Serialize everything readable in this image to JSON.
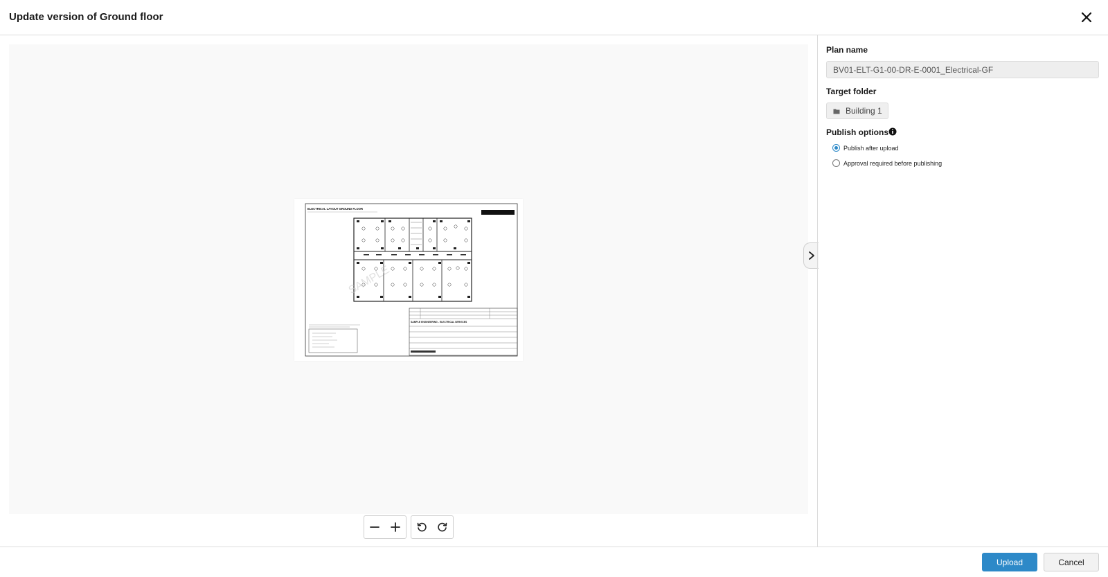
{
  "dialog": {
    "title": "Update version of Ground floor",
    "close_icon": "close-icon"
  },
  "preview": {
    "sheet": {
      "heading": "ELECTRICAL LAYOUT GROUND FLOOR",
      "title_block": "SAMPLE ENGINEERING - ELECTRICAL SERVICES",
      "watermark": "SAMPLE"
    },
    "toolbar": {
      "zoom_out_icon": "minus-icon",
      "zoom_in_icon": "plus-icon",
      "rotate_left_icon": "rotate-left-icon",
      "rotate_right_icon": "rotate-right-icon"
    },
    "collapse_icon": "chevron-right-icon"
  },
  "form": {
    "plan_name_label": "Plan name",
    "plan_name_value": "BV01-ELT-G1-00-DR-E-0001_Electrical-GF",
    "target_folder_label": "Target folder",
    "target_folder_value": "Building 1",
    "publish_options_label": "Publish options",
    "publish_options": [
      {
        "label": "Publish after upload",
        "selected": true
      },
      {
        "label": "Approval required before publishing",
        "selected": false
      }
    ]
  },
  "footer": {
    "upload_label": "Upload",
    "cancel_label": "Cancel"
  },
  "colors": {
    "accent": "#2d89c8",
    "canvas_bg": "#f9f9f9",
    "border": "#dcdcdc"
  }
}
